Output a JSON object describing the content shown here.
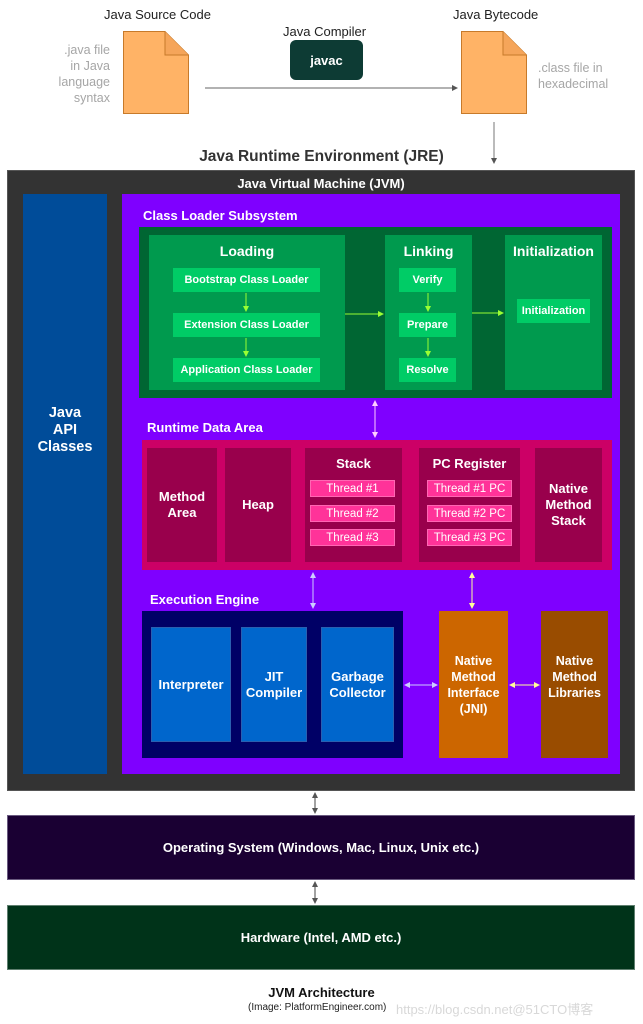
{
  "top": {
    "source_title": "Java Source Code",
    "source_desc": [
      ".java file",
      "in Java",
      "language",
      "syntax"
    ],
    "compiler_title": "Java Compiler",
    "compiler_button": "javac",
    "bytecode_title": "Java Bytecode",
    "bytecode_desc": [
      ".class file in",
      "hexadecimal"
    ],
    "file_icon_color": "#ffb366"
  },
  "jre": {
    "title": "Java Runtime Environment (JRE)"
  },
  "jvm": {
    "title": "Java Virtual Machine (JVM)",
    "api_classes": [
      "Java",
      "API",
      "Classes"
    ],
    "class_loader": {
      "title": "Class Loader Subsystem",
      "loading": {
        "title": "Loading",
        "items": [
          "Bootstrap Class Loader",
          "Extension Class Loader",
          "Application Class Loader"
        ]
      },
      "linking": {
        "title": "Linking",
        "items": [
          "Verify",
          "Prepare",
          "Resolve"
        ]
      },
      "initialization": {
        "title": "Initialization",
        "items": [
          "Initialization"
        ]
      }
    },
    "runtime_data_area": {
      "title": "Runtime Data Area",
      "method_area": [
        "Method",
        "Area"
      ],
      "heap": "Heap",
      "stack": {
        "title": "Stack",
        "threads": [
          "Thread #1",
          "Thread #2",
          "Thread #3"
        ]
      },
      "pc_register": {
        "title": "PC Register",
        "threads": [
          "Thread #1 PC",
          "Thread #2 PC",
          "Thread #3 PC"
        ]
      },
      "native_method_stack": [
        "Native",
        "Method",
        "Stack"
      ]
    },
    "execution_engine": {
      "title": "Execution Engine",
      "interpreter": "Interpreter",
      "jit": [
        "JIT",
        "Compiler"
      ],
      "gc": [
        "Garbage",
        "Collector"
      ]
    },
    "jni": [
      "Native",
      "Method",
      "Interface",
      "(JNI)"
    ],
    "native_libraries": [
      "Native",
      "Method",
      "Libraries"
    ]
  },
  "os": {
    "label": "Operating System (Windows, Mac, Linux, Unix etc.)"
  },
  "hardware": {
    "label": "Hardware (Intel, AMD etc.)"
  },
  "footer": {
    "caption": "JVM Architecture",
    "credit": "(Image: PlatformEngineer.com)",
    "watermark": "https://blog.csdn.net@51CTO博客"
  },
  "colors": {
    "jvm_bg": "#333333",
    "api_bg": "#004c99",
    "purple_bg": "#7f00ff",
    "class_loader_bg": "#006633",
    "runtime_bg": "#cc0066",
    "execution_bg": "#000066",
    "jni_bg": "#cc6600",
    "native_lib_bg": "#994c00",
    "os_bg": "#1a0033",
    "hw_bg": "#003319"
  }
}
